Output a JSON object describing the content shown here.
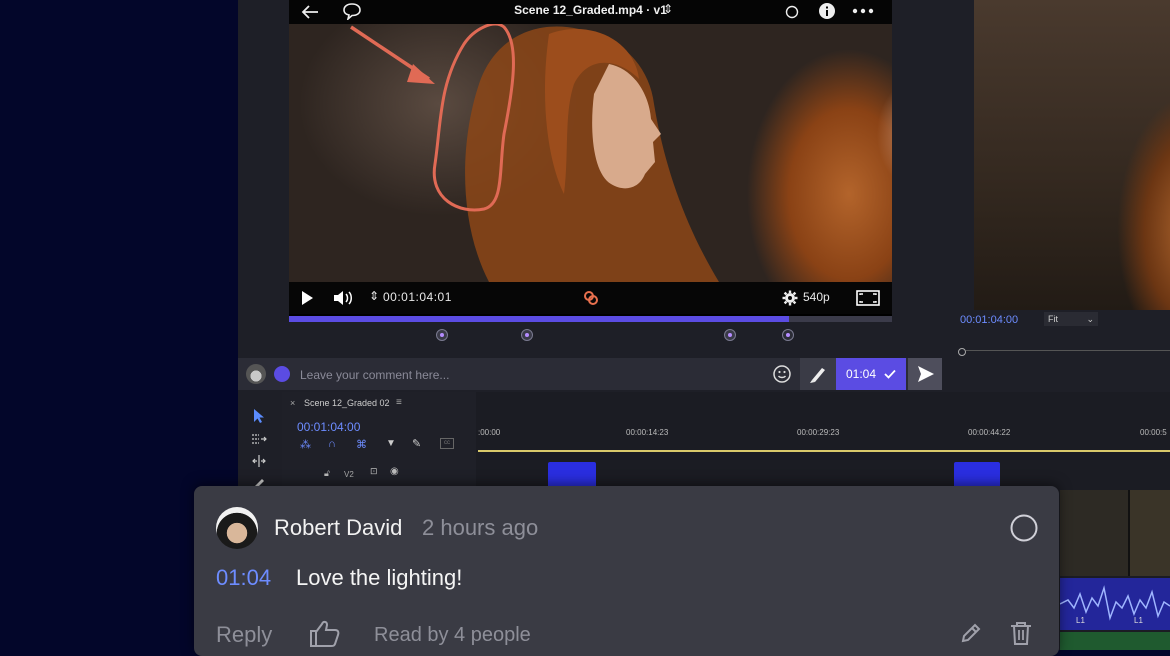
{
  "viewer": {
    "file_title": "Scene 12_Graded.mp4 · v1",
    "timecode": "00:01:04:01",
    "quality": "540p",
    "progress": 0.83
  },
  "comment_input": {
    "placeholder": "Leave your comment here...",
    "timecode_chip": "01:04"
  },
  "preview": {
    "timecode": "00:01:04:00",
    "zoom": "Fit"
  },
  "timeline": {
    "sequence_tab": "Scene 12_Graded 02",
    "playhead": "00:01:04:00",
    "ruler": [
      ":00:00",
      "00:00:14:23",
      "00:00:29:23",
      "00:00:44:22",
      "00:00:5"
    ],
    "track_v2": "V2",
    "audio_labels": [
      "L1",
      "L1"
    ]
  },
  "comment": {
    "author": "Robert David",
    "time_ago": "2 hours ago",
    "timestamp": "01:04",
    "text": "Love the lighting!",
    "reply_label": "Reply",
    "read_by": "Read by 4 people"
  },
  "colors": {
    "accent": "#5b4ce3",
    "timecode_text": "#6d8cff",
    "annotation": "#e06a55"
  }
}
